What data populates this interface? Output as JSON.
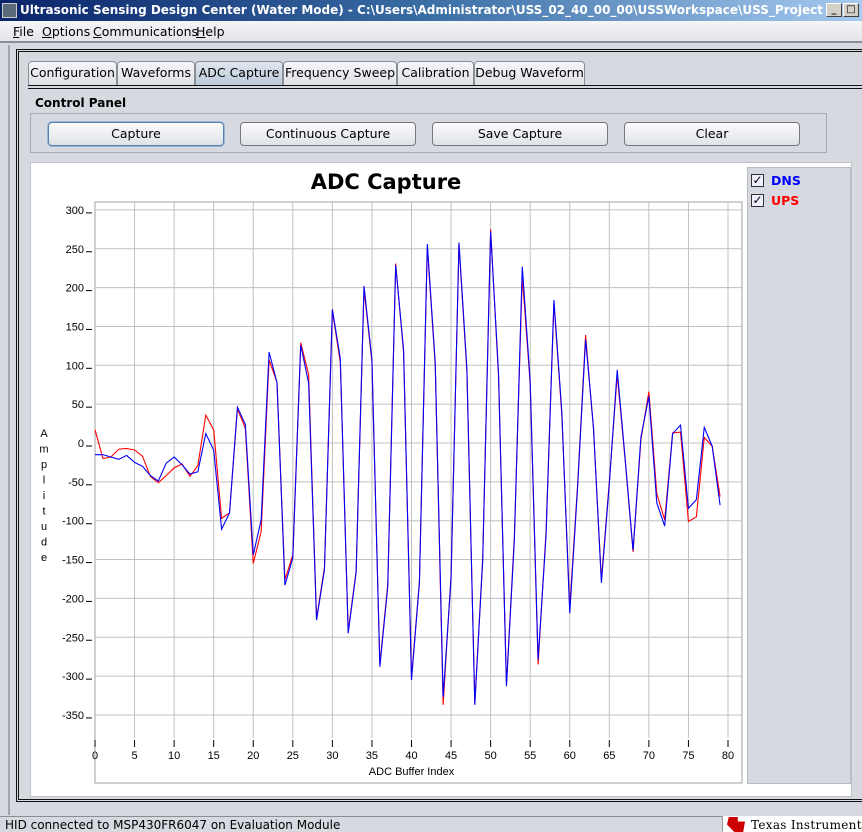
{
  "window": {
    "title": "Ultrasonic Sensing Design Center (Water Mode) - C:\\Users\\Administrator\\USS_02_40_00_00\\USSWorkspace\\USS_Project"
  },
  "menu": [
    {
      "label": "File",
      "key": "F",
      "rest": "ile"
    },
    {
      "label": "Options",
      "key": "O",
      "rest": "ptions"
    },
    {
      "label": "Communications",
      "key": "C",
      "rest": "ommunications"
    },
    {
      "label": "Help",
      "key": "H",
      "rest": "elp"
    }
  ],
  "tabs": [
    {
      "label": "Configuration"
    },
    {
      "label": "Waveforms"
    },
    {
      "label": "ADC Capture",
      "active": true
    },
    {
      "label": "Frequency Sweep"
    },
    {
      "label": "Calibration"
    },
    {
      "label": "Debug Waveform"
    }
  ],
  "control_panel": {
    "label": "Control Panel",
    "buttons": [
      "Capture",
      "Continuous Capture",
      "Save Capture",
      "Clear"
    ]
  },
  "legend": [
    {
      "label": "DNS",
      "color": "#0000ff",
      "checked": true
    },
    {
      "label": "UPS",
      "color": "#ff0000",
      "checked": true
    }
  ],
  "status": {
    "text": "HID connected to MSP430FR6047 on Evaluation Module",
    "logo": "Texas Instruments"
  },
  "chart_data": {
    "type": "line",
    "title": "ADC Capture",
    "xlabel": "ADC Buffer Index",
    "ylabel": "Amplitude",
    "xlim": [
      0,
      80
    ],
    "ylim": [
      -350,
      300
    ],
    "xticks": [
      0,
      5,
      10,
      15,
      20,
      25,
      30,
      35,
      40,
      45,
      50,
      55,
      60,
      65,
      70,
      75,
      80
    ],
    "yticks": [
      300,
      250,
      200,
      150,
      100,
      50,
      0,
      -50,
      -100,
      -150,
      -200,
      -250,
      -300,
      -350
    ],
    "grid": true,
    "legend_position": "right",
    "series": [
      {
        "name": "DNS",
        "color": "#0000ff",
        "values": [
          -15,
          -15,
          -18,
          -21,
          -16,
          -25,
          -30,
          -42,
          -49,
          -26,
          -18,
          -28,
          -40,
          -37,
          12,
          -9,
          -111,
          -90,
          46,
          24,
          -144,
          -99,
          117,
          78,
          -183,
          -148,
          126,
          77,
          -228,
          -163,
          172,
          109,
          -245,
          -167,
          202,
          107,
          -288,
          -185,
          229,
          120,
          -305,
          -180,
          256,
          103,
          -327,
          -174,
          258,
          96,
          -337,
          -151,
          272,
          90,
          -313,
          -125,
          227,
          80,
          -279,
          -120,
          184,
          40,
          -219,
          -56,
          133,
          20,
          -180,
          -53,
          94,
          -20,
          -138,
          8,
          60,
          -77,
          -107,
          12,
          23,
          -84,
          -73,
          20,
          -4,
          -80
        ]
      },
      {
        "name": "UPS",
        "color": "#ff0000",
        "values": [
          17,
          -20,
          -18,
          -8,
          -7,
          -9,
          -17,
          -43,
          -51,
          -42,
          -32,
          -27,
          -43,
          -29,
          36,
          17,
          -97,
          -90,
          44,
          19,
          -155,
          -114,
          107,
          78,
          -176,
          -144,
          129,
          88,
          -226,
          -160,
          170,
          104,
          -242,
          -165,
          198,
          104,
          -285,
          -182,
          231,
          116,
          -302,
          -178,
          252,
          100,
          -337,
          -170,
          255,
          92,
          -335,
          -148,
          275,
          85,
          -310,
          -120,
          215,
          76,
          -285,
          -115,
          180,
          36,
          -212,
          -52,
          139,
          18,
          -176,
          -50,
          88,
          -22,
          -140,
          5,
          66,
          -65,
          -99,
          13,
          14,
          -101,
          -95,
          7,
          -4,
          -69
        ]
      }
    ]
  }
}
